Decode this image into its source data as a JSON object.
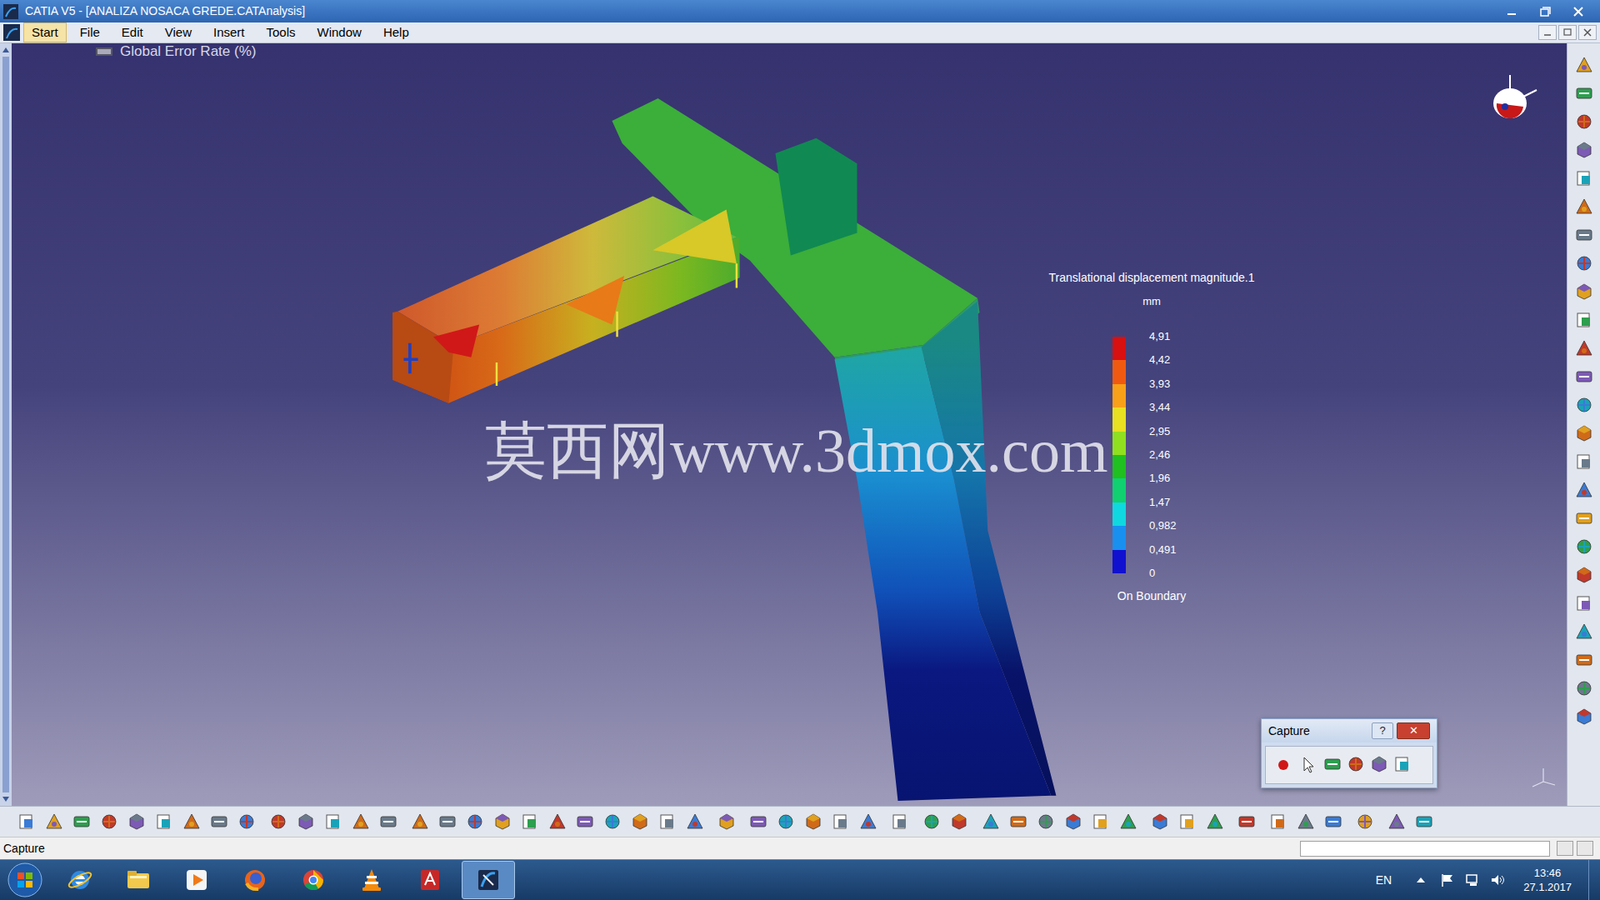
{
  "window": {
    "title": "CATIA V5 - [ANALIZA NOSACA GREDE.CATAnalysis]"
  },
  "menu": [
    {
      "label": "Start",
      "highlighted": true
    },
    {
      "label": "File",
      "highlighted": false
    },
    {
      "label": "Edit",
      "highlighted": false
    },
    {
      "label": "View",
      "highlighted": false
    },
    {
      "label": "Insert",
      "highlighted": false
    },
    {
      "label": "Tools",
      "highlighted": false
    },
    {
      "label": "Window",
      "highlighted": false
    },
    {
      "label": "Help",
      "highlighted": false
    }
  ],
  "tree": {
    "item": "Global Error Rate (%)"
  },
  "watermark": "莫西网www.3dmox.com",
  "legend": {
    "title": "Translational displacement magnitude.1",
    "unit": "mm",
    "values": [
      "4,91",
      "4,42",
      "3,93",
      "3,44",
      "2,95",
      "2,46",
      "1,96",
      "1,47",
      "0,982",
      "0,491",
      "0"
    ],
    "bands": [
      {
        "color": "#d81010"
      },
      {
        "color": "#f05a10"
      },
      {
        "color": "#f8a018"
      },
      {
        "color": "#e8e020"
      },
      {
        "color": "#90e020"
      },
      {
        "color": "#20c020"
      },
      {
        "color": "#10d070"
      },
      {
        "color": "#10d8e0"
      },
      {
        "color": "#1890f0"
      },
      {
        "color": "#1010d0"
      }
    ],
    "footer": "On Boundary"
  },
  "capture_dialog": {
    "title": "Capture",
    "help": "?",
    "close": "✕"
  },
  "status_bar": {
    "text": "Capture"
  },
  "taskbar": {
    "items": [
      {
        "selected": false
      },
      {
        "selected": false
      },
      {
        "selected": false
      },
      {
        "selected": false
      },
      {
        "selected": false
      },
      {
        "selected": false
      },
      {
        "selected": false
      },
      {
        "selected": true
      }
    ],
    "language": "EN",
    "time": "13:46",
    "date": "27.1.2017"
  }
}
